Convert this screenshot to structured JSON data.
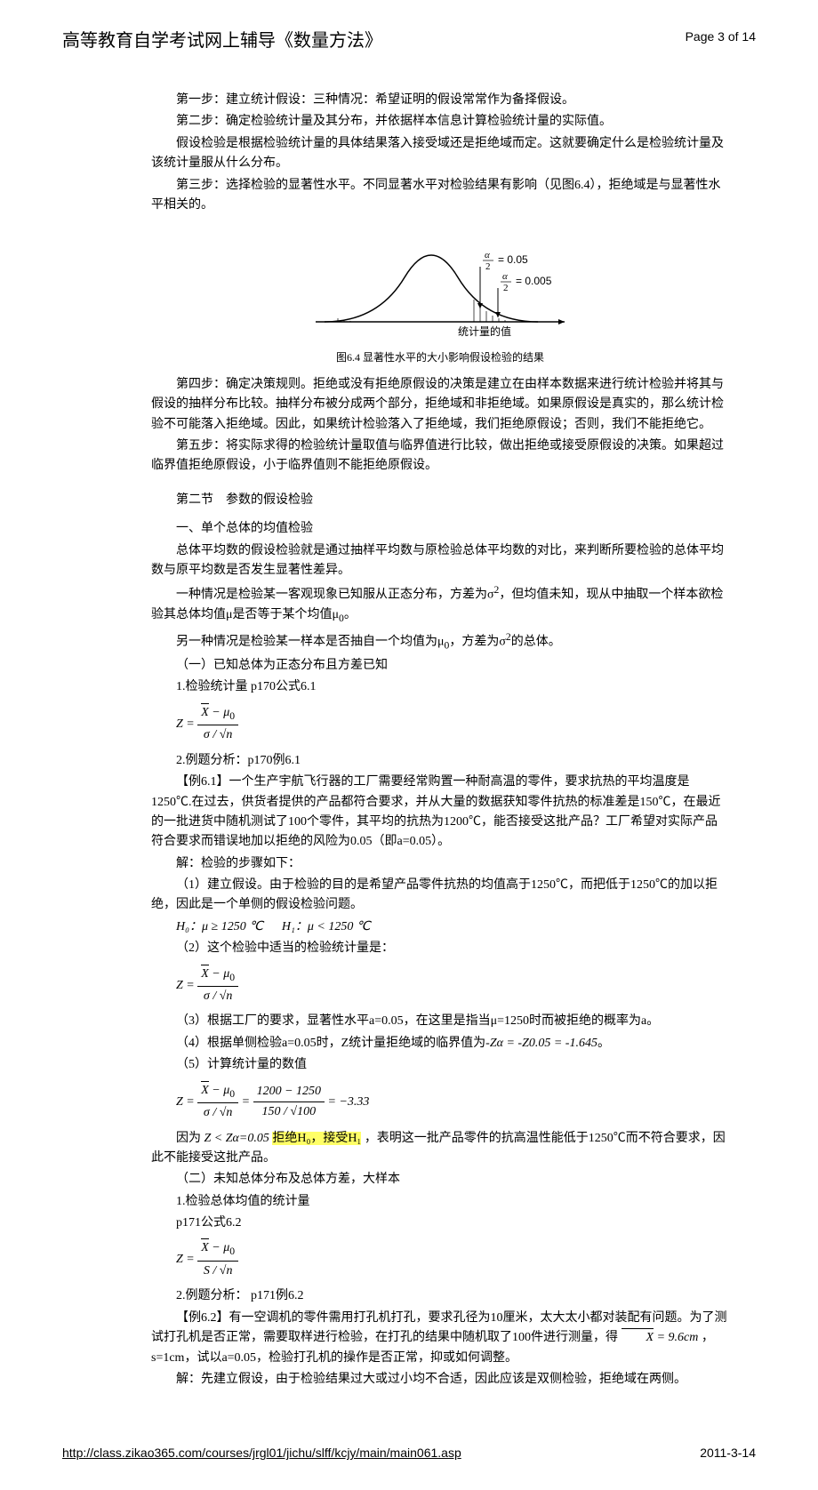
{
  "header": {
    "title": "高等教育自学考试网上辅导《数量方法》",
    "page": "Page 3 of 14"
  },
  "steps": {
    "s1": "第一步：建立统计假设：三种情况：希望证明的假设常常作为备择假设。",
    "s2": "第二步：确定检验统计量及其分布，并依据样本信息计算检验统计量的实际值。",
    "s2b": "假设检验是根据检验统计量的具体结果落入接受域还是拒绝域而定。这就要确定什么是检验统计量及该统计量服从什么分布。",
    "s3": "第三步：选择检验的显著性水平。不同显著水平对检验结果有影响（见图6.4），拒绝域是与显著性水平相关的。"
  },
  "figure": {
    "alpha005": "= 0.05",
    "alpha0005": "= 0.005",
    "alpha_label1": "α",
    "alpha_label2": "2",
    "xaxis": "统计量的值",
    "caption": "图6.4 显著性水平的大小影响假设检验的结果"
  },
  "steps2": {
    "s4": "第四步：确定决策规则。拒绝或没有拒绝原假设的决策是建立在由样本数据来进行统计检验并将其与假设的抽样分布比较。抽样分布被分成两个部分，拒绝域和非拒绝域。如果原假设是真实的，那么统计检验不可能落入拒绝域。因此，如果统计检验落入了拒绝域，我们拒绝原假设；否则，我们不能拒绝它。",
    "s5": "第五步：将实际求得的检验统计量取值与临界值进行比较，做出拒绝或接受原假设的决策。如果超过临界值拒绝原假设，小于临界值则不能拒绝原假设。"
  },
  "sec2": {
    "title": "第二节　参数的假设检验",
    "sub1": "一、单个总体的均值检验",
    "p1": "总体平均数的假设检验就是通过抽样平均数与原检验总体平均数的对比，来判断所要检验的总体平均数与原平均数是否发生显著性差异。",
    "p2a": "一种情况是检验某一客观现象已知服从正态分布，方差为σ",
    "p2b": "，但均值未知，现从中抽取一个样本欲检验其总体均值μ是否等于某个均值μ",
    "p2c": "。",
    "p3a": "另一种情况是检验某一样本是否抽自一个均值为μ",
    "p3b": "，方差为σ",
    "p3c": "的总体。",
    "sub1_1": "（一）已知总体为正态分布且方差已知",
    "item1": "1.检验统计量 p170公式6.1",
    "item2": "2.例题分析：p170例6.1",
    "ex61": "【例6.1】一个生产宇航飞行器的工厂需要经常购置一种耐高温的零件，要求抗热的平均温度是1250℃.在过去，供货者提供的产品都符合要求，并从大量的数据获知零件抗热的标准差是150℃，在最近的一批进货中随机测试了100个零件，其平均的抗热为1200℃，能否接受这批产品？工厂希望对实际产品符合要求而错误地加以拒绝的风险为0.05（即a=0.05）。",
    "sol_intro": "解：检验的步骤如下：",
    "sol1": "（1）建立假设。由于检验的目的是希望产品零件抗热的均值高于1250℃，而把低于1250℃的加以拒绝，因此是一个单侧的假设检验问题。",
    "h0": "H₀：μ ≥ 1250 ℃",
    "h1": "H₁：μ < 1250 ℃",
    "sol2": "（2）这个检验中适当的检验统计量是：",
    "sol3": "（3）根据工厂的要求，显著性水平a=0.05，在这里是指当μ=1250时而被拒绝的概率为a。",
    "sol4a": "（4）根据单侧检验a=0.05时，Z统计量拒绝域的临界值为",
    "sol4b": "-Zα = -Z0.05 = -1.645",
    "sol4c": "。",
    "sol5": "（5）计算统计量的数值",
    "calc_num": "1200 − 1250",
    "calc_den": "150 / √100",
    "calc_res": "= −3.33",
    "conclude_a": "因为",
    "conclude_b": "Z < Zα=0.05",
    "conclude_c": "拒绝H₀，接受H₁",
    "conclude_d": "，表明这一批产品零件的抗高温性能低于1250℃而不符合要求，因此不能接受这批产品。",
    "sub1_2": "（二）未知总体分布及总体方差，大样本",
    "item2_1": "1.检验总体均值的统计量",
    "item2_1b": "p171公式6.2",
    "item2_2": "2.例题分析： p171例6.2",
    "ex62": "【例6.2】有一空调机的零件需用打孔机打孔，要求孔径为10厘米，太大太小都对装配有问题。为了测试打孔机是否正常，需要取样进行检验，在打孔的结果中随机取了100件进行测量，得",
    "ex62_xbar": "X̄ = 9.6cm",
    "ex62_b": "，s=1cm，试以a=0.05，检验打孔机的操作是否正常，抑或如何调整。",
    "sol62": "解：先建立假设，由于检验结果过大或过小均不合适，因此应该是双侧检验，拒绝域在两侧。"
  },
  "formula_parts": {
    "Z_eq": "Z =",
    "xbar_mu0": "X̄ − μ₀",
    "sigma_sqrtn": "σ / √n",
    "s_sqrtn": "S / √n"
  },
  "footer": {
    "url": "http://class.zikao365.com/courses/jrgl01/jichu/slff/kcjy/main/main061.asp",
    "date": "2011-3-14"
  }
}
